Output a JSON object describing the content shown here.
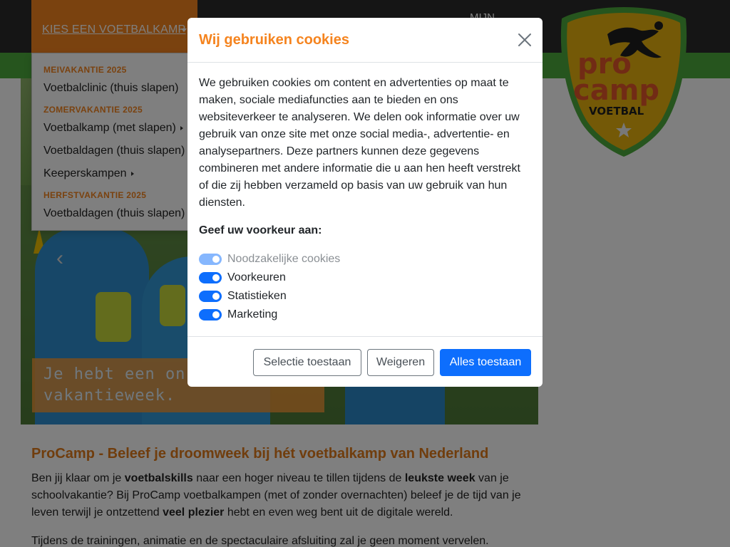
{
  "nav": {
    "active_label": "KIES EEN VOETBALKAMP",
    "account_label": "MIJN"
  },
  "logo": {
    "line1": "pro",
    "line2": "camp",
    "line3": "VOETBAL"
  },
  "dropdown": {
    "sections": [
      {
        "heading": "MEIVAKANTIE 2025",
        "items": [
          {
            "label": "Voetbalclinic (thuis slapen)",
            "submenu": false
          }
        ]
      },
      {
        "heading": "ZOMERVAKANTIE 2025",
        "items": [
          {
            "label": "Voetbalkamp (met slapen)",
            "submenu": true
          },
          {
            "label": "Voetbaldagen (thuis slapen)",
            "submenu": false
          },
          {
            "label": "Keeperskampen",
            "submenu": true
          }
        ]
      },
      {
        "heading": "HERFSTVAKANTIE 2025",
        "items": [
          {
            "label": "Voetbaldagen (thuis slapen)",
            "submenu": false
          }
        ]
      }
    ]
  },
  "hero": {
    "banner_line1": "Je hebt een on",
    "banner_line2": "vakantieweek."
  },
  "content": {
    "title": "ProCamp - Beleef je droomweek bij hét voetbalkamp van Nederland",
    "p1_a": "Ben jij klaar om je ",
    "p1_b": "voetbalskills",
    "p1_c": " naar een hoger niveau te tillen tijdens de ",
    "p1_d": "leukste week",
    "p1_e": " van je schoolvakantie? Bij ProCamp voetbalkampen (met of zonder overnachten) beleef je de tijd van je leven terwijl je ontzettend ",
    "p1_f": "veel plezier",
    "p1_g": " hebt en even weg bent uit de digitale wereld.",
    "p2": "Tijdens de trainingen, animatie en de spectaculaire afsluiting zal je geen moment vervelen."
  },
  "cookie_modal": {
    "title": "Wij gebruiken cookies",
    "body": "We gebruiken cookies om content en advertenties op maat te maken, sociale mediafuncties aan te bieden en ons websiteverkeer te analyseren. We delen ook informatie over uw gebruik van onze site met onze social media-, advertentie- en analysepartners. Deze partners kunnen deze gegevens combineren met andere informatie die u aan hen heeft verstrekt of die zij hebben verzameld op basis van uw gebruik van hun diensten.",
    "preference_label": "Geef uw voorkeur aan:",
    "toggles": [
      {
        "label": "Noodzakelijke cookies",
        "checked": true,
        "disabled": true
      },
      {
        "label": "Voorkeuren",
        "checked": true,
        "disabled": false
      },
      {
        "label": "Statistieken",
        "checked": true,
        "disabled": false
      },
      {
        "label": "Marketing",
        "checked": true,
        "disabled": false
      }
    ],
    "buttons": {
      "selection": "Selectie toestaan",
      "decline": "Weigeren",
      "accept_all": "Alles toestaan"
    }
  },
  "colors": {
    "brand_orange": "#f5841f",
    "brand_green": "#4caa3c",
    "primary_blue": "#0d6efd",
    "topbar_dark": "#2a2a2a"
  }
}
